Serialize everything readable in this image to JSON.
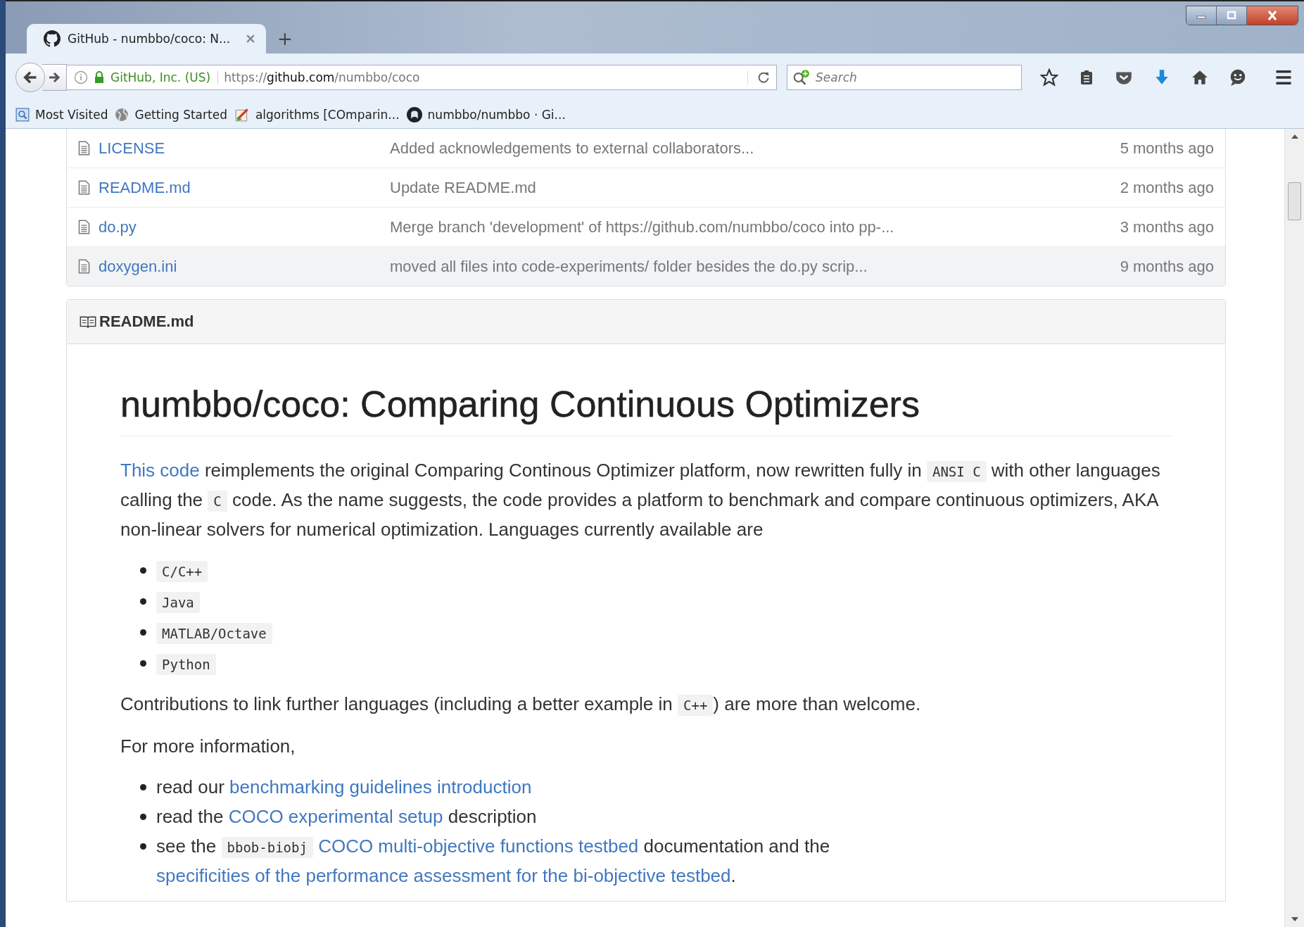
{
  "browser": {
    "tab": {
      "title": "GitHub - numbbo/coco: N...",
      "selected": true
    },
    "new_tab": "+",
    "identity": "GitHub, Inc. (US)",
    "url": {
      "scheme": "https://",
      "host": "github.com",
      "path": "/numbbo/coco"
    },
    "search": {
      "placeholder": "Search"
    },
    "bookmarks": [
      {
        "label": "Most Visited"
      },
      {
        "label": "Getting Started"
      },
      {
        "label": "algorithms [COmparin..."
      },
      {
        "label": "numbbo/numbbo · Gi..."
      }
    ]
  },
  "files": [
    {
      "name": "LICENSE",
      "message": "Added acknowledgements to external collaborators...",
      "age": "5 months ago",
      "selected": false
    },
    {
      "name": "README.md",
      "message": "Update README.md",
      "age": "2 months ago",
      "selected": false
    },
    {
      "name": "do.py",
      "message": "Merge branch 'development' of https://github.com/numbbo/coco into pp-...",
      "age": "3 months ago",
      "selected": false
    },
    {
      "name": "doxygen.ini",
      "message": "moved all files into code-experiments/ folder besides the do.py scrip...",
      "age": "9 months ago",
      "selected": true
    }
  ],
  "readme": {
    "filename": "README.md",
    "title": "numbbo/coco: Comparing Continuous Optimizers",
    "blocks": [
      {
        "kind": "paragraph",
        "parts": [
          {
            "kind": "link",
            "text": "This code"
          },
          {
            "kind": "text",
            "text": " reimplements the original Comparing Continous Optimizer platform, now rewritten fully in "
          },
          {
            "kind": "code",
            "text": "ANSI C"
          },
          {
            "kind": "text",
            "text": " with other languages calling the "
          },
          {
            "kind": "code",
            "text": "C"
          },
          {
            "kind": "text",
            "text": " code. As the name suggests, the code provides a platform to benchmark and compare continuous optimizers, AKA non-linear solvers for numerical optimization. Languages currently available are"
          }
        ]
      },
      {
        "kind": "list",
        "items": [
          [
            {
              "kind": "code",
              "text": "C/C++"
            }
          ],
          [
            {
              "kind": "code",
              "text": "Java"
            }
          ],
          [
            {
              "kind": "code",
              "text": "MATLAB/Octave"
            }
          ],
          [
            {
              "kind": "code",
              "text": "Python"
            }
          ]
        ]
      },
      {
        "kind": "paragraph",
        "parts": [
          {
            "kind": "text",
            "text": "Contributions to link further languages (including a better example in "
          },
          {
            "kind": "code",
            "text": "C++"
          },
          {
            "kind": "text",
            "text": ") are more than welcome."
          }
        ]
      },
      {
        "kind": "paragraph",
        "parts": [
          {
            "kind": "text",
            "text": "For more information,"
          }
        ]
      },
      {
        "kind": "list",
        "items": [
          [
            {
              "kind": "text",
              "text": "read our "
            },
            {
              "kind": "link",
              "text": "benchmarking guidelines introduction"
            }
          ],
          [
            {
              "kind": "text",
              "text": "read the "
            },
            {
              "kind": "link",
              "text": "COCO experimental setup"
            },
            {
              "kind": "text",
              "text": " description"
            }
          ],
          [
            {
              "kind": "text",
              "text": "see the "
            },
            {
              "kind": "code",
              "text": "bbob-biobj"
            },
            {
              "kind": "link",
              "text": "COCO multi-objective functions testbed"
            },
            {
              "kind": "text",
              "text": " documentation and the "
            },
            {
              "kind": "link",
              "text": "specificities of the performance assessment for the bi-objective testbed"
            },
            {
              "kind": "text",
              "text": "."
            }
          ]
        ]
      }
    ]
  }
}
